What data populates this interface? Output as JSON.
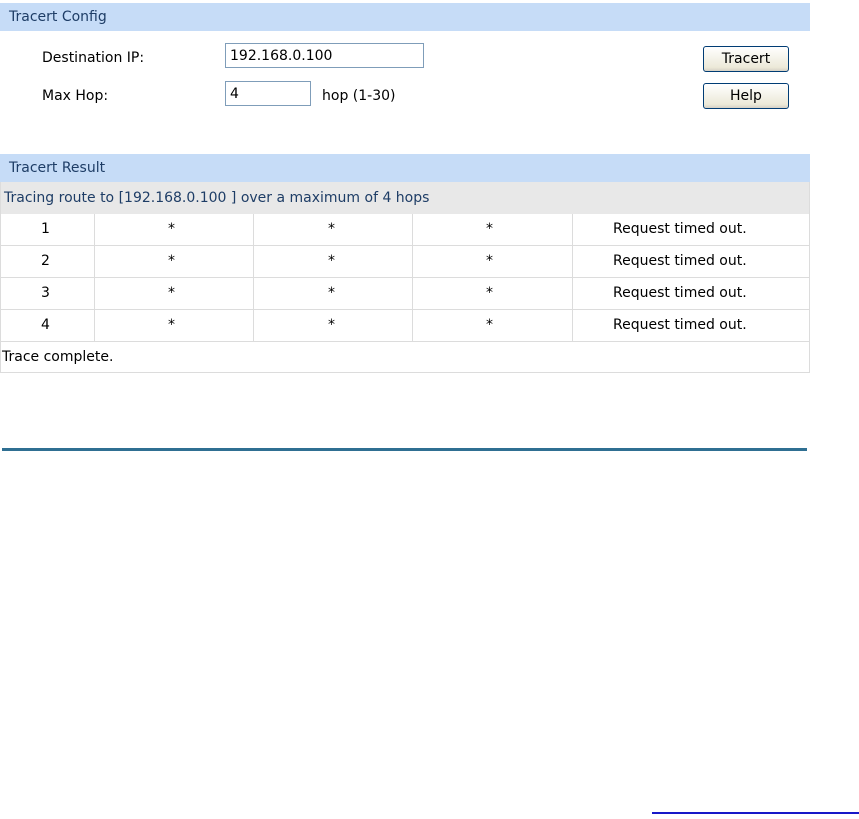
{
  "config": {
    "title": "Tracert Config",
    "destination_ip_label": "Destination IP:",
    "destination_ip_value": "192.168.0.100",
    "max_hop_label": "Max Hop:",
    "max_hop_value": "4",
    "max_hop_hint": "hop (1-30)",
    "tracert_button": "Tracert",
    "help_button": "Help"
  },
  "result": {
    "title": "Tracert Result",
    "summary": "Tracing route to [192.168.0.100 ] over a maximum of 4 hops",
    "rows": [
      {
        "hop": "1",
        "t1": "*",
        "t2": "*",
        "t3": "*",
        "message": "Request timed out."
      },
      {
        "hop": "2",
        "t1": "*",
        "t2": "*",
        "t3": "*",
        "message": "Request timed out."
      },
      {
        "hop": "3",
        "t1": "*",
        "t2": "*",
        "t3": "*",
        "message": "Request timed out."
      },
      {
        "hop": "4",
        "t1": "*",
        "t2": "*",
        "t3": "*",
        "message": "Request timed out."
      }
    ],
    "complete": "Trace complete."
  },
  "colors": {
    "section_header_bg": "#c6dcf7",
    "section_header_text": "#1e3d66",
    "summary_bg": "#e8e8e8",
    "divider": "#2f6f92",
    "link": "#1818c8"
  }
}
